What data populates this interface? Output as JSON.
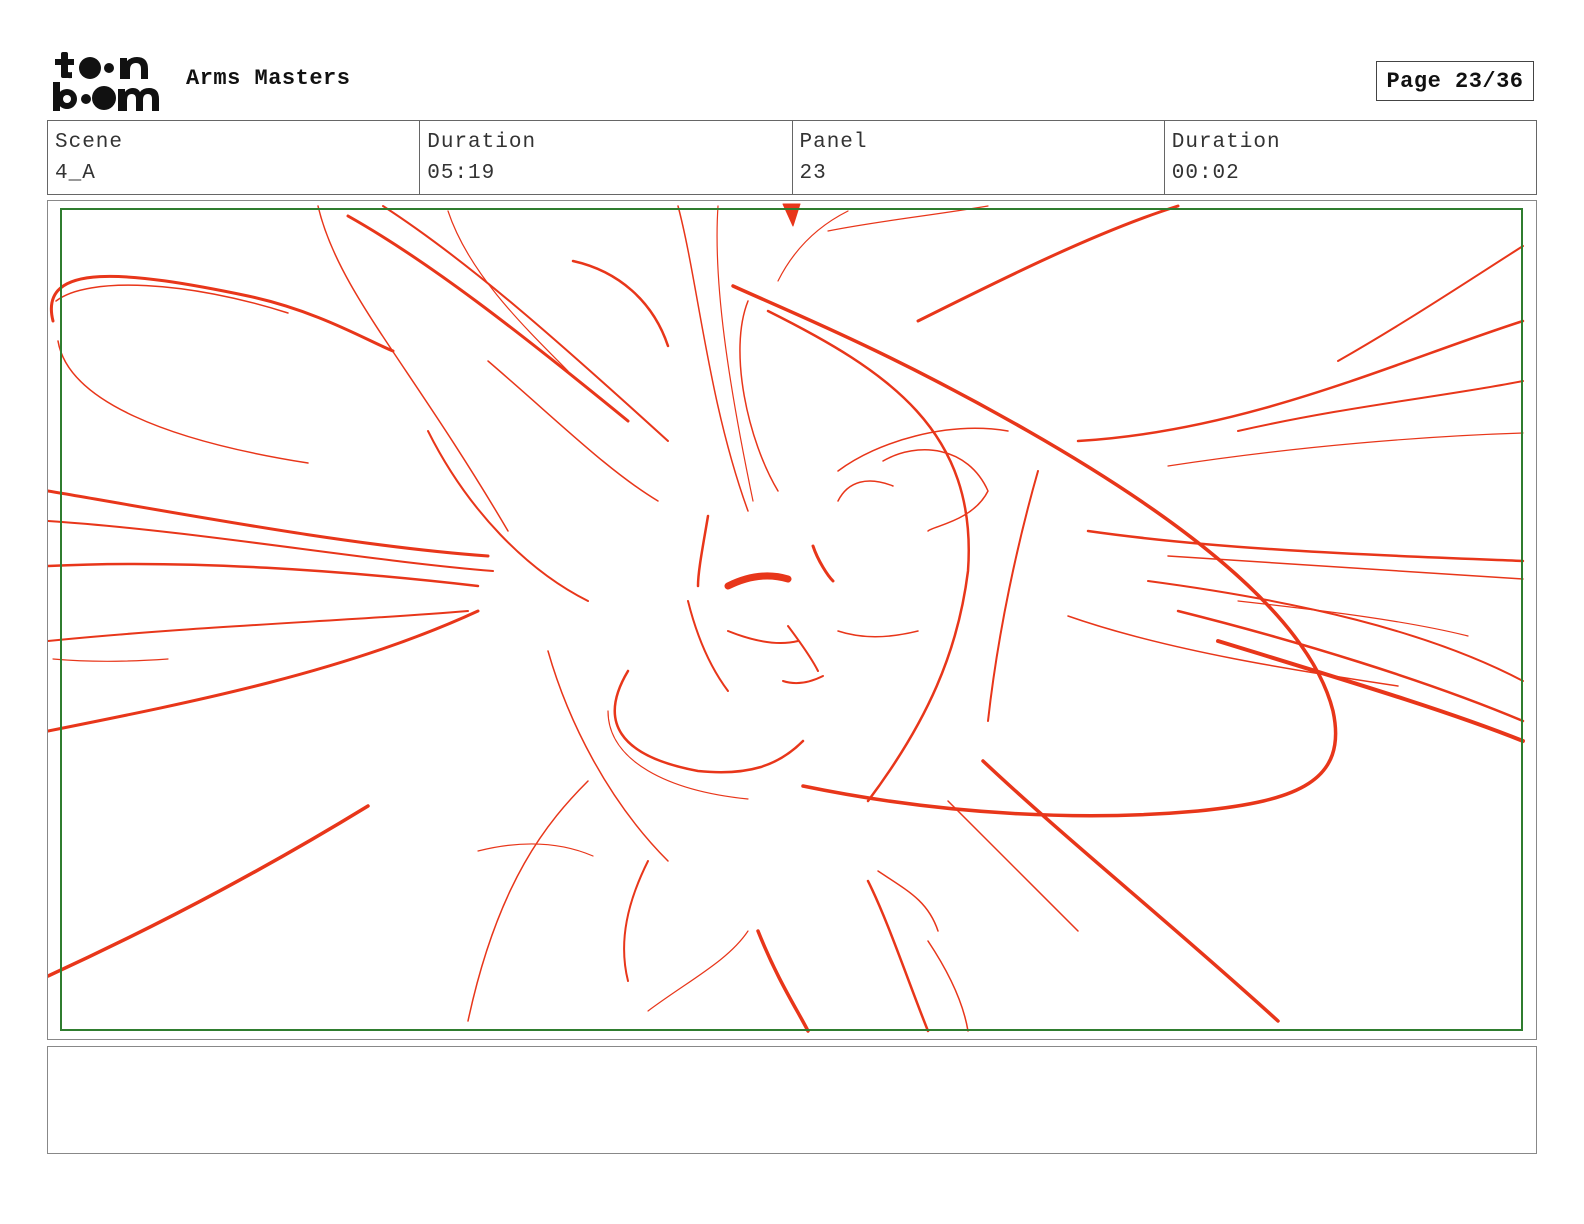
{
  "header": {
    "logo_top": "toon",
    "logo_bottom": "boom",
    "project_title": "Arms Masters",
    "page_label": "Page 23/36"
  },
  "info": {
    "scene_label": "Scene",
    "scene_value": "4_A",
    "scene_duration_label": "Duration",
    "scene_duration_value": "05:19",
    "panel_label": "Panel",
    "panel_value": "23",
    "panel_duration_label": "Duration",
    "panel_duration_value": "00:02"
  },
  "panel": {
    "stroke_color": "#e8361a",
    "safe_area_color": "#2f7d2f"
  },
  "notes": {
    "text": ""
  }
}
